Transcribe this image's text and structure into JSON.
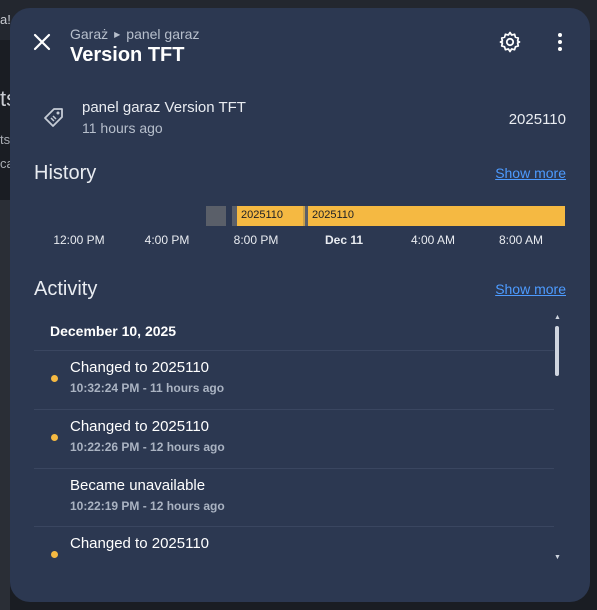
{
  "background": {
    "text1": "a!",
    "text2": "ts",
    "text3": "ts",
    "text4": "ca"
  },
  "dialog": {
    "breadcrumb": [
      "Garaż",
      "panel garaz"
    ],
    "title": "Version TFT",
    "icons": {
      "close": "close-icon",
      "settings": "gear-icon",
      "more": "more-vert-icon",
      "entity": "tag-icon"
    }
  },
  "entity": {
    "name": "panel garaz Version TFT",
    "time": "11 hours ago",
    "state": "2025110"
  },
  "history": {
    "title": "History",
    "show_more": "Show more",
    "bars": [
      {
        "label": "",
        "state": "unavailable",
        "color": "#5a5f69"
      },
      {
        "label": "2025110",
        "state": "2025110",
        "color": "#f5b942"
      },
      {
        "label": "2025110",
        "state": "2025110",
        "color": "#f5b942"
      }
    ],
    "ticks": [
      {
        "label": "12:00 PM",
        "bold": false
      },
      {
        "label": "4:00 PM",
        "bold": false
      },
      {
        "label": "8:00 PM",
        "bold": false
      },
      {
        "label": "Dec 11",
        "bold": true
      },
      {
        "label": "4:00 AM",
        "bold": false
      },
      {
        "label": "8:00 AM",
        "bold": false
      }
    ]
  },
  "activity": {
    "title": "Activity",
    "show_more": "Show more",
    "date": "December 10, 2025",
    "events": [
      {
        "title": "Changed to 2025110",
        "meta": "10:32:24 PM - 11 hours ago",
        "dot": true
      },
      {
        "title": "Changed to 2025110",
        "meta": "10:22:26 PM - 12 hours ago",
        "dot": true
      },
      {
        "title": "Became unavailable",
        "meta": "10:22:19 PM - 12 hours ago",
        "dot": false
      },
      {
        "title": "Changed to 2025110",
        "meta": "",
        "dot": true
      }
    ]
  },
  "colors": {
    "accent": "#f5b942",
    "link": "#4d9bff",
    "surface": "#2c3851"
  }
}
